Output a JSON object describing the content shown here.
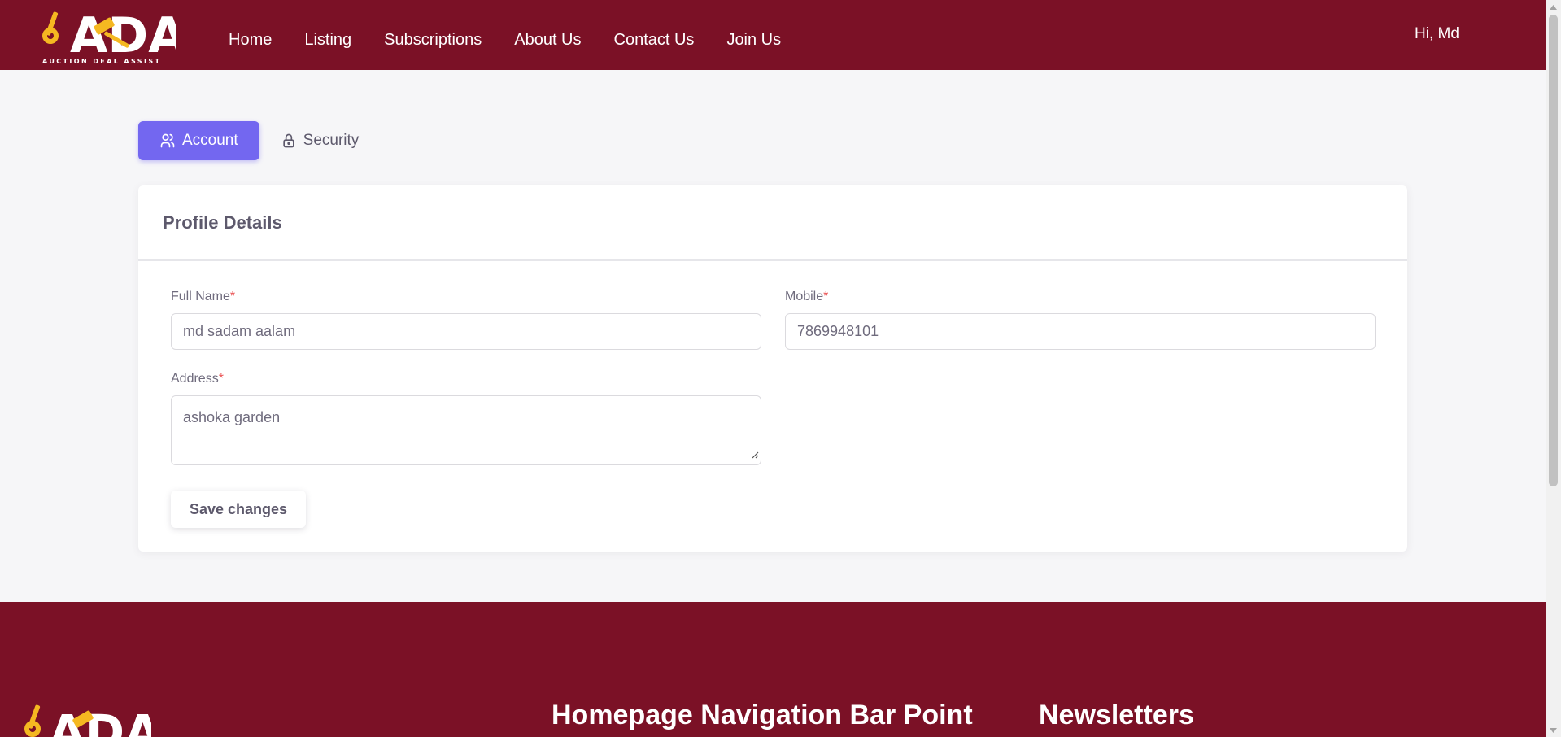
{
  "header": {
    "logo_text": "ADA",
    "logo_tagline": "AUCTION DEAL ASSIST",
    "nav": [
      "Home",
      "Listing",
      "Subscriptions",
      "About Us",
      "Contact Us",
      "Join Us"
    ],
    "greeting": "Hi, Md"
  },
  "tabs": [
    {
      "label": "Account",
      "icon": "users-icon",
      "active": true
    },
    {
      "label": "Security",
      "icon": "lock-icon",
      "active": false
    }
  ],
  "profile": {
    "title": "Profile Details",
    "full_name_label": "Full Name",
    "full_name_value": "md sadam aalam",
    "mobile_label": "Mobile",
    "mobile_value": "7869948101",
    "address_label": "Address",
    "address_value": "ashoka garden",
    "required_mark": "*",
    "save_label": "Save changes"
  },
  "footer": {
    "logo_text": "ADA",
    "heading_nav": "Homepage Navigation Bar Point",
    "heading_newsletters": "Newsletters"
  },
  "colors": {
    "brand": "#7b1126",
    "accent": "#7367f0",
    "logo_gold": "#f5b821",
    "required": "#ea5455"
  }
}
